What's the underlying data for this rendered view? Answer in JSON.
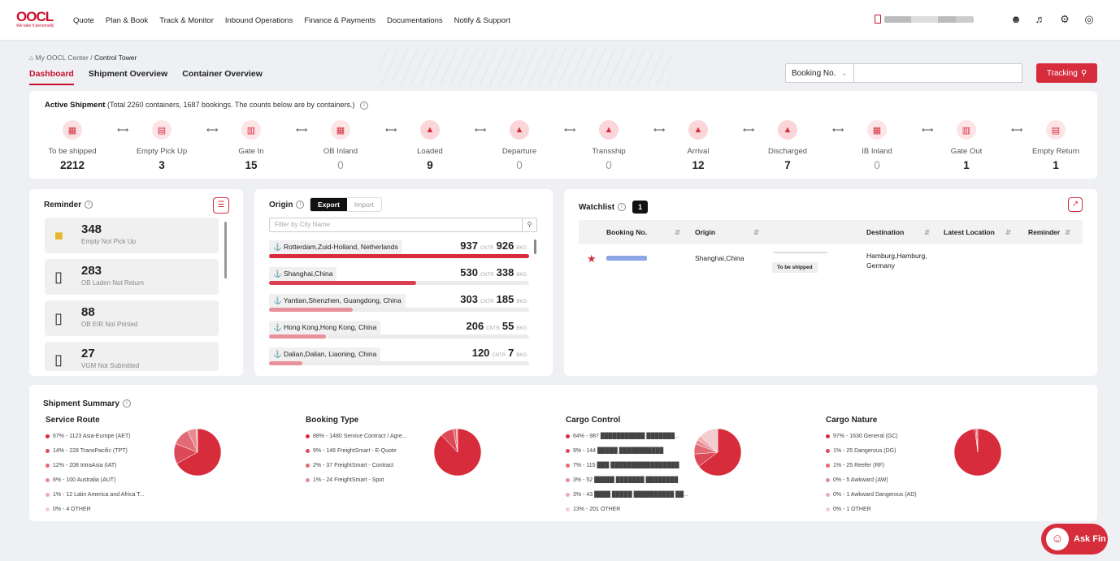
{
  "logo": {
    "text": "OOCL",
    "tagline": "We take it personally"
  },
  "nav": [
    "Quote",
    "Plan & Book",
    "Track & Monitor",
    "Inbound Operations",
    "Finance & Payments",
    "Documentations",
    "Notify & Support"
  ],
  "user": {
    "name": "████████ ████ ███ ███"
  },
  "breadcrumb": {
    "home": "My OOCL Center",
    "sep": "/",
    "current": "Control Tower"
  },
  "tabs": [
    "Dashboard",
    "Shipment Overview",
    "Container Overview"
  ],
  "search": {
    "type": "Booking No.",
    "button": "Tracking"
  },
  "active_shipment": {
    "title": "Active Shipment",
    "note": "(Total 2260 containers, 1687 bookings. The counts below are by containers.)",
    "stages": [
      {
        "label": "To be shipped",
        "value": "2212"
      },
      {
        "label": "Empty Pick Up",
        "value": "3"
      },
      {
        "label": "Gate In",
        "value": "15"
      },
      {
        "label": "OB Inland",
        "value": "0"
      },
      {
        "label": "Loaded",
        "value": "9"
      },
      {
        "label": "Departure",
        "value": "0"
      },
      {
        "label": "Transship",
        "value": "0"
      },
      {
        "label": "Arrival",
        "value": "12"
      },
      {
        "label": "Discharged",
        "value": "7"
      },
      {
        "label": "IB Inland",
        "value": "0"
      },
      {
        "label": "Gate Out",
        "value": "1"
      },
      {
        "label": "Empty Return",
        "value": "1"
      }
    ]
  },
  "reminder": {
    "title": "Reminder",
    "items": [
      {
        "count": "348",
        "label": "Empty Not Pick Up"
      },
      {
        "count": "283",
        "label": "OB Laden Not Return"
      },
      {
        "count": "88",
        "label": "OB EIR Not Printed"
      },
      {
        "count": "27",
        "label": "VGM Not Submitted"
      }
    ]
  },
  "origin": {
    "title": "Origin",
    "toggle": [
      "Export",
      "Import"
    ],
    "filter_placeholder": "Filter by City Name",
    "unit_cntr": "CNTR",
    "unit_bkg": "BKG",
    "rows": [
      {
        "city": "Rotterdam,Zuid-Holland, Netherlands",
        "cntr": "937",
        "bkg": "926",
        "pct": 1.0
      },
      {
        "city": "Shanghai,China",
        "cntr": "530",
        "bkg": "338",
        "pct": 0.566
      },
      {
        "city": "Yantian,Shenzhen, Guangdong, China",
        "cntr": "303",
        "bkg": "185",
        "pct": 0.323
      },
      {
        "city": "Hong Kong,Hong Kong, China",
        "cntr": "206",
        "bkg": "55",
        "pct": 0.22
      },
      {
        "city": "Dalian,Dalian, Liaoning, China",
        "cntr": "120",
        "bkg": "7",
        "pct": 0.128
      }
    ]
  },
  "watchlist": {
    "title": "Watchlist",
    "count": "1",
    "columns": [
      "Booking No.",
      "Origin",
      "Destination",
      "Latest Location",
      "Reminder"
    ],
    "rows": [
      {
        "booking": "██████████",
        "origin": "Shanghai,China",
        "status": "To be shipped",
        "destination": "Hamburg,Hamburg, Germany",
        "latest": "",
        "reminder": ""
      }
    ]
  },
  "summary": {
    "title": "Shipment Summary",
    "columns": [
      {
        "title": "Service Route",
        "items": [
          {
            "text": "67% - 1123 Asia-Europe (AET)",
            "color": "#d62c3c"
          },
          {
            "text": "14% - 228 TransPacific (TPT)",
            "color": "#dc4a57"
          },
          {
            "text": "12% - 208 IntraAsia (IAT)",
            "color": "#e26a74"
          },
          {
            "text": "6% - 100 Australia (AUT)",
            "color": "#e88b92"
          },
          {
            "text": "1% - 12 Latin America and Africa T...",
            "color": "#eeacb1"
          },
          {
            "text": "0% - 4 OTHER",
            "color": "#f4cdd0"
          }
        ]
      },
      {
        "title": "Booking Type",
        "items": [
          {
            "text": "88% - 1480 Service Contract / Agre...",
            "color": "#d62c3c"
          },
          {
            "text": "9% - 146 FreightSmart - E-Quote",
            "color": "#dc4a57"
          },
          {
            "text": "2% - 37 FreightSmart - Contract",
            "color": "#e26a74"
          },
          {
            "text": "1% - 24 FreightSmart - Spot",
            "color": "#e88b92"
          }
        ]
      },
      {
        "title": "Cargo Control",
        "items": [
          {
            "text": "64% - 987 ███████████ ███████...",
            "color": "#d62c3c"
          },
          {
            "text": "9% - 144 █████ ███████████",
            "color": "#dc4a57"
          },
          {
            "text": "7% - 115 ███ █████████████████",
            "color": "#e26a74"
          },
          {
            "text": "3% - 52 █████ ███████ ████████",
            "color": "#e88b92"
          },
          {
            "text": "3% - 43 ████ █████ ██████████ ██...",
            "color": "#eeacb1"
          },
          {
            "text": "13% - 201 OTHER",
            "color": "#f4cdd0"
          }
        ]
      },
      {
        "title": "Cargo Nature",
        "items": [
          {
            "text": "97% - 1630 General (GC)",
            "color": "#d62c3c"
          },
          {
            "text": "1% - 25 Dangerous (DG)",
            "color": "#dc4a57"
          },
          {
            "text": "1% - 25 Reefer (RF)",
            "color": "#e26a74"
          },
          {
            "text": "0% - 5 Awkward (AW)",
            "color": "#e88b92"
          },
          {
            "text": "0% - 1 Awkward Dangerous (AD)",
            "color": "#eeacb1"
          },
          {
            "text": "0% - 1 OTHER",
            "color": "#f4cdd0"
          }
        ]
      }
    ],
    "pies": [
      [
        67,
        14,
        12,
        6,
        1,
        0
      ],
      [
        88,
        9,
        2,
        1
      ],
      [
        64,
        9,
        7,
        3,
        3,
        13
      ],
      [
        97,
        1,
        1,
        0,
        0,
        0
      ]
    ]
  },
  "ask": {
    "label": "Ask Fin"
  },
  "colors": {
    "brand": "#d62c3c"
  }
}
